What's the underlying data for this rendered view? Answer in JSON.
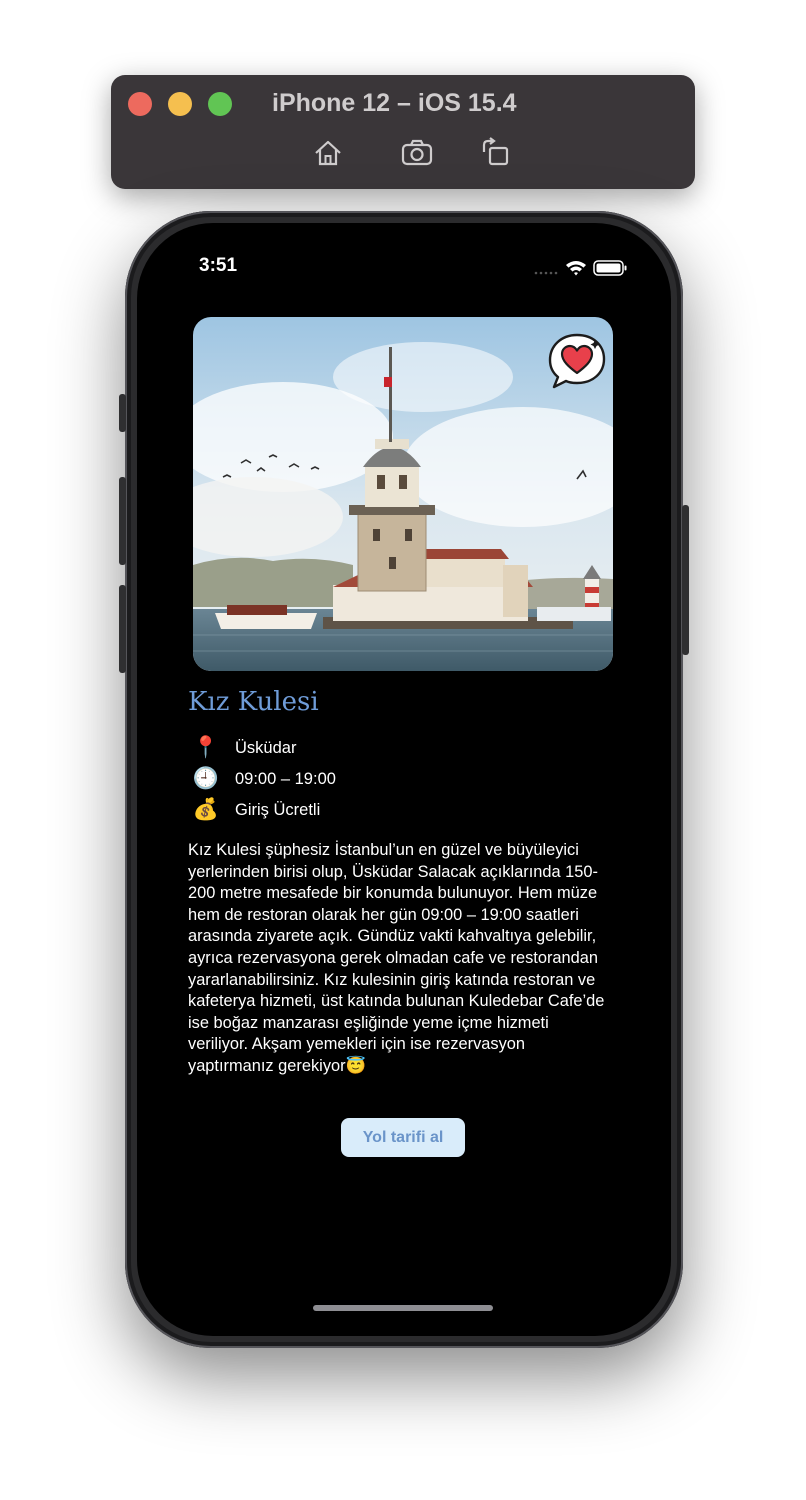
{
  "simulator": {
    "title": "iPhone 12 – iOS 15.4",
    "toolbar": [
      "home-icon",
      "screenshot-icon",
      "rotate-icon"
    ]
  },
  "status_bar": {
    "time": "3:51",
    "icons": [
      "signal-dots-icon",
      "wifi-icon",
      "battery-icon"
    ]
  },
  "place": {
    "title": "Kız Kulesi",
    "favorite_icon": "heart-bubble-icon",
    "info": [
      {
        "icon": "map-pin-icon",
        "glyph": "📍",
        "text": "Üsküdar"
      },
      {
        "icon": "clock-icon",
        "glyph": "🕘",
        "text": "09:00 – 19:00"
      },
      {
        "icon": "money-bag-icon",
        "glyph": "💰",
        "text": "Giriş Ücretli"
      }
    ],
    "description": "Kız Kulesi şüphesiz İstanbul’un en güzel ve büyüleyici yerlerinden birisi olup, Üsküdar Salacak açıklarında 150-200 metre mesafede bir konumda bulunuyor. Hem müze hem de restoran olarak her gün 09:00 – 19:00 saatleri arasında ziyarete açık. Gündüz vakti kahvaltıya gelebilir, ayrıca rezervasyona gerek olmadan cafe ve restorandan yararlanabilirsiniz. Kız kulesinin giriş katında restoran ve kafeterya hizmeti, üst katında bulunan Kuledebar Cafe’de ise boğaz manzarası eşliğinde yeme içme hizmeti veriliyor. Akşam yemekleri için ise rezervasyon yaptırmanız gerekiyor😇",
    "button_label": "Yol tarifi al"
  },
  "colors": {
    "title": "#6f9cd8",
    "button_bg": "#d9ecfa",
    "button_text": "#6a94c9",
    "screen_bg": "#000000"
  }
}
